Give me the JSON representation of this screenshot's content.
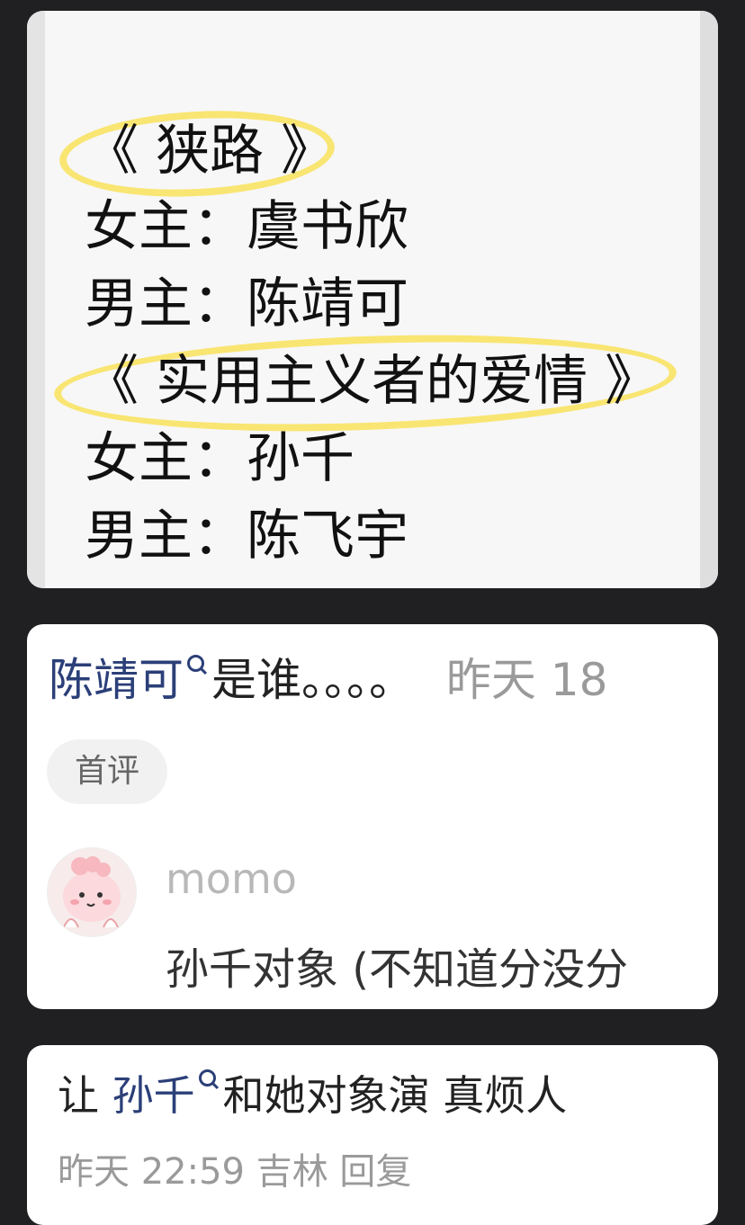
{
  "note": {
    "title1": "《 狭路 》",
    "line1": "女主：虞书欣",
    "line2": "男主：陈靖可",
    "title2": "《 实用主义者的爱情 》",
    "line3": "女主：孙千",
    "line4": "男主：陈飞宇",
    "highlight_color": "#f9e25a"
  },
  "comment": {
    "mention": "陈靖可",
    "text": "是谁。。。。",
    "time": "昨天 18",
    "badge": "首评",
    "reply_user": "momo",
    "reply_text": "孙千对象 (不知道分没分"
  },
  "comment2": {
    "prefix": "让",
    "mention": "孙千",
    "text": "和她对象演  真烦人",
    "meta": "昨天 22:59 吉林 回复"
  }
}
